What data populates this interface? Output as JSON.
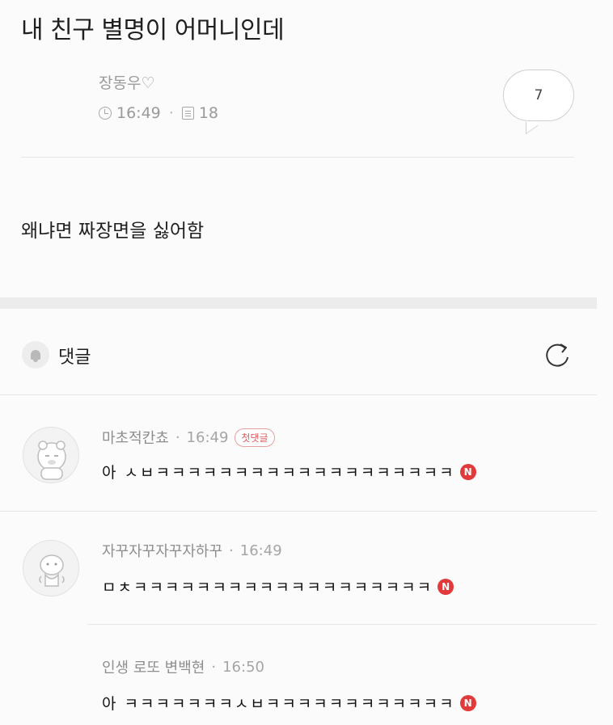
{
  "post": {
    "title": "내 친구 별명이 어머니인데",
    "author": "장동우♡",
    "time": "16:49",
    "views": "18",
    "comment_count": "7",
    "body": "왜냐면 짜장면을 싫어함"
  },
  "comments_section": {
    "label": "댓글",
    "icons": {
      "bell": "bell-icon",
      "refresh": "refresh-icon"
    }
  },
  "comments": [
    {
      "author": "마초적칸쵸",
      "time": "16:49",
      "badge": "첫댓글",
      "text": "아 ㅅㅂㅋㅋㅋㅋㅋㅋㅋㅋㅋㅋㅋㅋㅋㅋㅋㅋㅋㅋㅋ",
      "new": "N"
    },
    {
      "author": "자꾸자꾸자꾸자하꾸",
      "time": "16:49",
      "text": "ㅁㅊㅋㅋㅋㅋㅋㅋㅋㅋㅋㅋㅋㅋㅋㅋㅋㅋㅋㅋㅋ",
      "new": "N"
    },
    {
      "author": "인생 로또 변백현",
      "time": "16:50",
      "text": "아 ㅋㅋㅋㅋㅋㅋㅋㅅㅂㅋㅋㅋㅋㅋㅋㅋㅋㅋㅋㅋㅋ",
      "new": "N"
    }
  ],
  "colors": {
    "new_badge": "#e23a3a",
    "first_comment_badge": "#e05c5c"
  }
}
